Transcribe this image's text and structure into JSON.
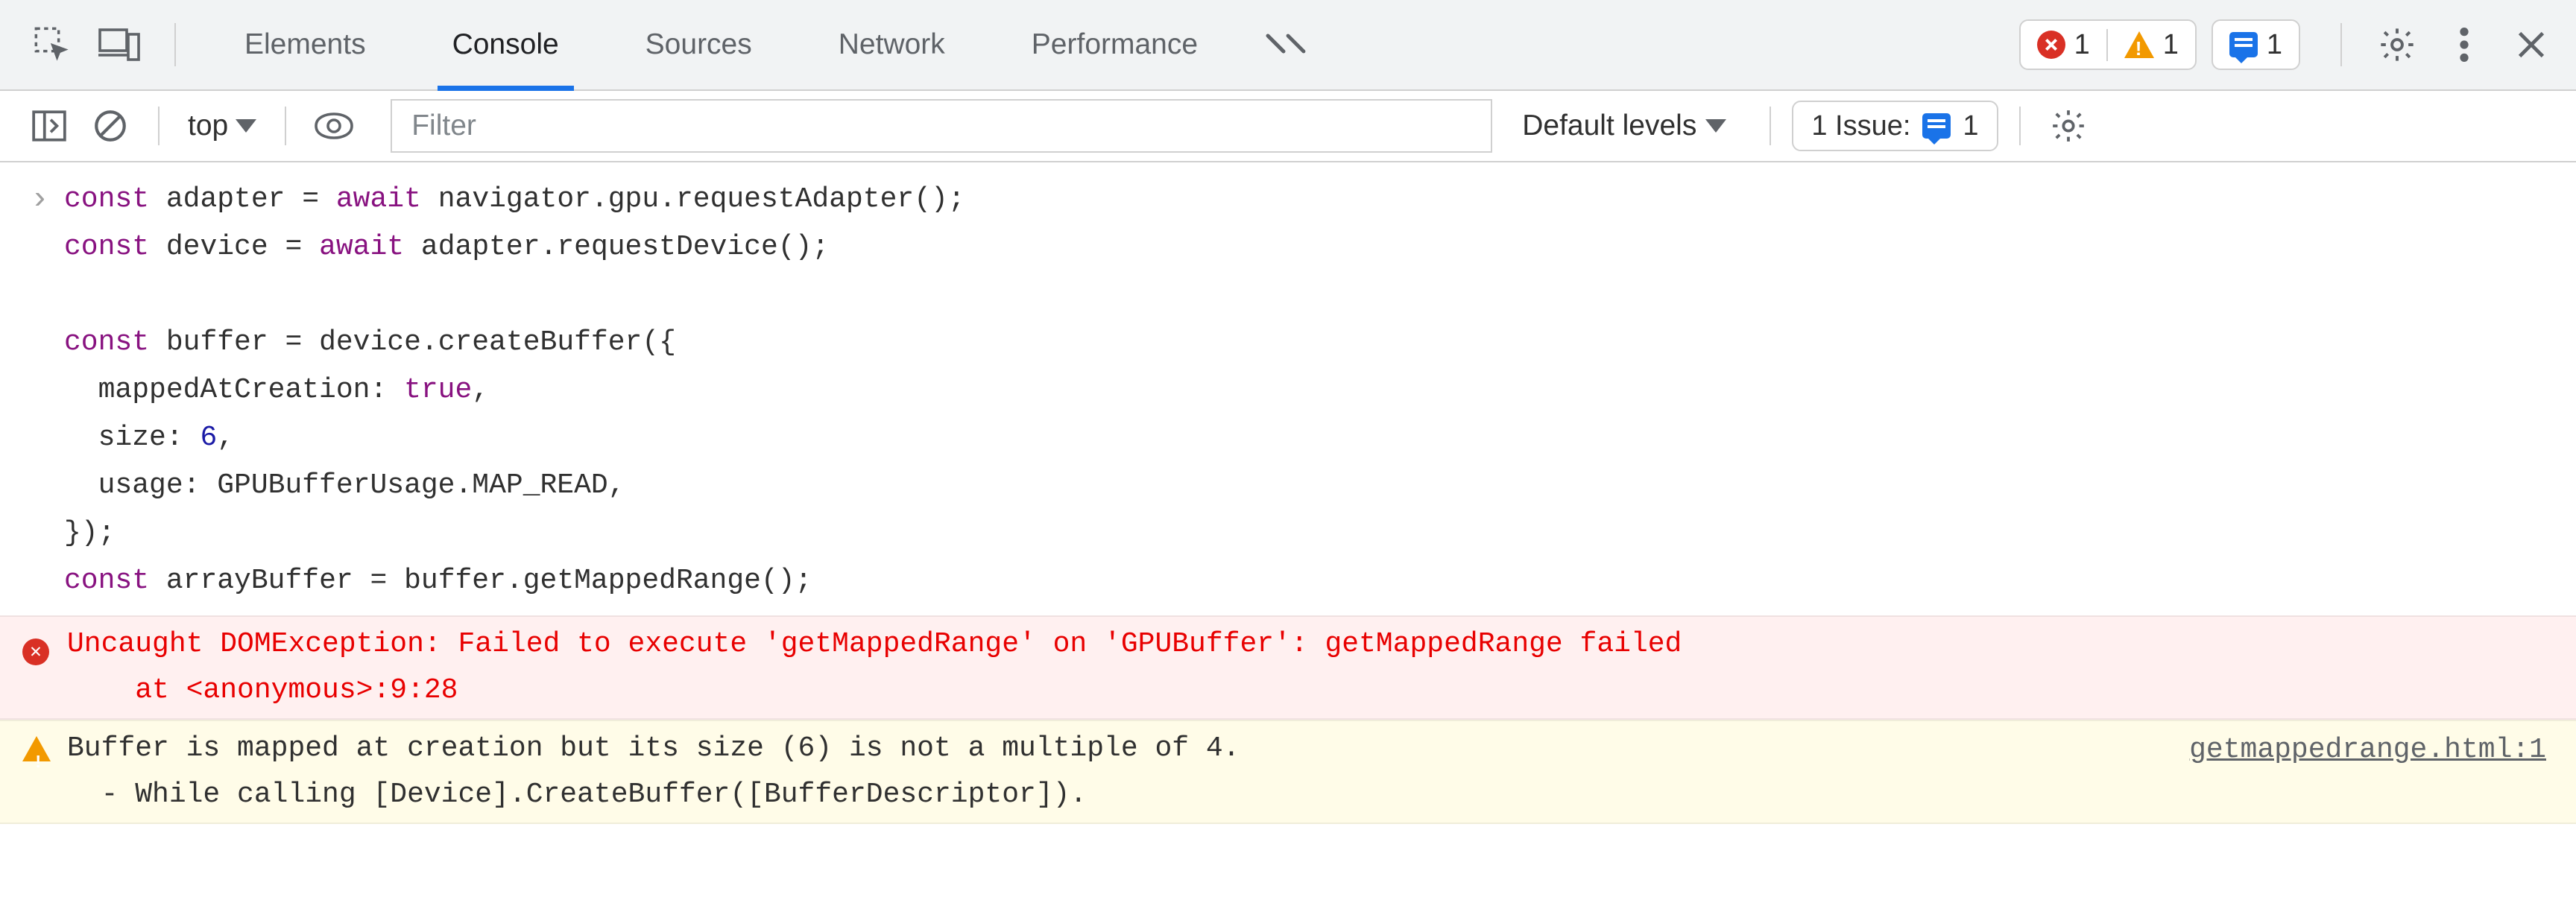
{
  "tabs": {
    "elements": "Elements",
    "console": "Console",
    "sources": "Sources",
    "network": "Network",
    "performance": "Performance"
  },
  "counts": {
    "errors": "1",
    "warnings": "1",
    "issues": "1"
  },
  "toolbar": {
    "context": "top",
    "filter_placeholder": "Filter",
    "levels": "Default levels",
    "issue_label": "1 Issue:",
    "issue_count": "1"
  },
  "code": {
    "text": "const adapter = await navigator.gpu.requestAdapter();\nconst device = await adapter.requestDevice();\n\nconst buffer = device.createBuffer({\n  mappedAtCreation: true,\n  size: 6,\n  usage: GPUBufferUsage.MAP_READ,\n});\nconst arrayBuffer = buffer.getMappedRange();"
  },
  "messages": {
    "error": {
      "text": "Uncaught DOMException: Failed to execute 'getMappedRange' on 'GPUBuffer': getMappedRange failed\n    at <anonymous>:9:28"
    },
    "warning": {
      "text": "Buffer is mapped at creation but its size (6) is not a multiple of 4.\n  - While calling [Device].CreateBuffer([BufferDescriptor]).",
      "link": "getmappedrange.html:1"
    }
  }
}
